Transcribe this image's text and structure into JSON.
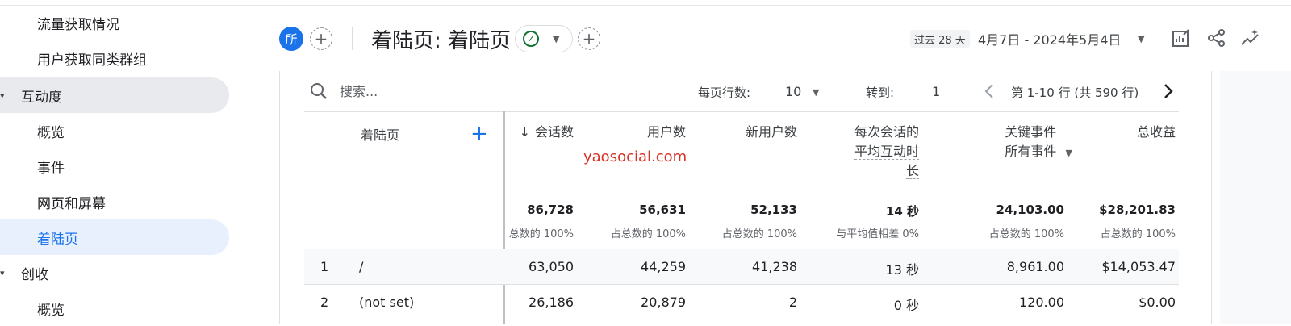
{
  "sidebar": {
    "items": [
      {
        "label": "流量获取情况"
      },
      {
        "label": "用户获取同类群组"
      },
      {
        "label": "互动度"
      },
      {
        "label": "概览"
      },
      {
        "label": "事件"
      },
      {
        "label": "网页和屏幕"
      },
      {
        "label": "着陆页"
      },
      {
        "label": "创收"
      },
      {
        "label": "概览"
      }
    ]
  },
  "header": {
    "avatar": "所",
    "title": "着陆页: 着陆页",
    "date_chip": "过去 28 天",
    "date_range": "4月7日 - 2024年5月4日"
  },
  "toolbar": {
    "search_placeholder": "搜索...",
    "rows_per_page_label": "每页行数:",
    "rows_per_page_value": "10",
    "goto_label": "转到:",
    "goto_value": "1",
    "pagination": "第 1-10 行 (共 590 行)"
  },
  "table": {
    "dimension_header": "着陆页",
    "columns": [
      {
        "label": "会话数",
        "total": "86,728",
        "total_sub": "总数的 100%"
      },
      {
        "label": "用户数",
        "total": "56,631",
        "total_sub": "占总数的 100%"
      },
      {
        "label": "新用户数",
        "total": "52,133",
        "total_sub": "占总数的 100%"
      },
      {
        "label_lines": [
          "每次会话的",
          "平均互动时",
          "长"
        ],
        "total": "14 秒",
        "total_sub": "与平均值相差 0%"
      },
      {
        "label": "关键事件",
        "sub_label": "所有事件",
        "total": "24,103.00",
        "total_sub": "占总数的 100%"
      },
      {
        "label": "总收益",
        "total": "$28,201.83",
        "total_sub": "占总数的 100%"
      }
    ],
    "rows": [
      {
        "index": "1",
        "dimension": "/",
        "values": [
          "63,050",
          "44,259",
          "41,238",
          "13 秒",
          "8,961.00",
          "$14,053.47"
        ]
      },
      {
        "index": "2",
        "dimension": "(not set)",
        "values": [
          "26,186",
          "20,879",
          "2",
          "0 秒",
          "120.00",
          "$0.00"
        ]
      }
    ]
  },
  "watermark": "yaosocial.com"
}
